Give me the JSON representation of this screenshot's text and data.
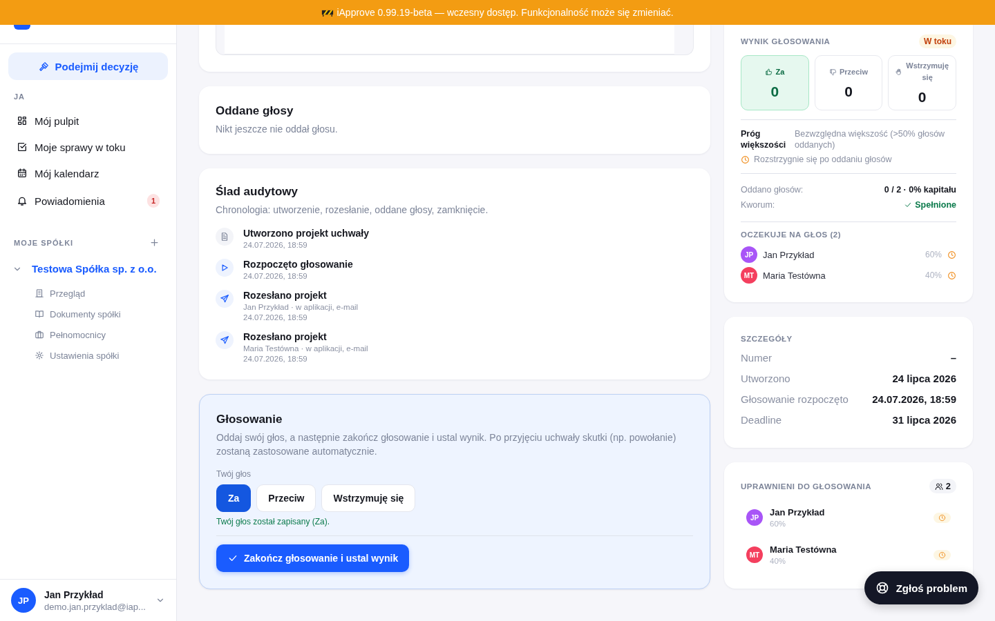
{
  "banner": {
    "text": "iApprove 0.99.19-beta — wczesny dostęp. Funkcjonalność może się zmieniać."
  },
  "sidebar": {
    "action_button": "Podejmij decyzję",
    "section_title": "JA",
    "items": [
      {
        "label": "Mój pulpit",
        "selected": false
      },
      {
        "label": "Moje sprawy w toku",
        "selected": false
      },
      {
        "label": "Mój kalendarz",
        "selected": false
      },
      {
        "label": "Powiadomienia",
        "selected": false,
        "badge": "1"
      }
    ],
    "companies_title": "MOJE SPÓŁKI",
    "companies": [
      {
        "name": "Testowa Spółka sp. z o.o.",
        "expanded": true,
        "children": [
          {
            "label": "Przegląd"
          },
          {
            "label": "Dokumenty spółki"
          },
          {
            "label": "Pełnomocnicy"
          },
          {
            "label": "Ustawienia spółki"
          }
        ]
      }
    ],
    "user": {
      "initials": "JP",
      "name": "Jan Przykład",
      "email": "demo.jan.przyklad@iap..."
    }
  },
  "votes_card": {
    "title": "Oddane głosy",
    "text": "Nikt jeszcze nie oddał głosu."
  },
  "audit": {
    "title": "Ślad audytowy",
    "subtitle": "Chronologia: utworzenie, rozesłanie, oddane głosy, zamknięcie.",
    "events": [
      {
        "kind": "created",
        "title": "Utworzono projekt uchwały",
        "time": "24.07.2026, 18:59"
      },
      {
        "kind": "started",
        "title": "Rozpoczęto głosowanie",
        "time": "24.07.2026, 18:59"
      },
      {
        "kind": "sent",
        "title": "Rozesłano projekt",
        "detail": "Jan Przykład · w aplikacji, e-mail",
        "time": "24.07.2026, 18:59"
      },
      {
        "kind": "sent",
        "title": "Rozesłano projekt",
        "detail": "Maria Testówna · w aplikacji, e-mail",
        "time": "24.07.2026, 18:59"
      }
    ]
  },
  "voting": {
    "title": "Głosowanie",
    "text": "Oddaj swój głos, a następnie zakończ głosowanie i ustal wynik. Po przyjęciu uchwały skutki (np. powołanie) zostaną zastosowane automatycznie.",
    "label": "Twój głos",
    "options": [
      {
        "label": "Za",
        "selected": true
      },
      {
        "label": "Przeciw",
        "selected": false
      },
      {
        "label": "Wstrzymuję się",
        "selected": false
      }
    ],
    "message": "Twój głos został zapisany (Za).",
    "finish_button": "Zakończ głosowanie i ustal wynik"
  },
  "result": {
    "title": "WYNIK GŁOSOWANIA",
    "status": "W toku",
    "tally": [
      {
        "kind": "for",
        "label": "Za",
        "count": "0",
        "highlighted": true
      },
      {
        "kind": "against",
        "label": "Przeciw",
        "count": "0",
        "highlighted": false
      },
      {
        "kind": "abstain",
        "label": "Wstrzymuję się",
        "count": "0",
        "highlighted": false
      }
    ],
    "threshold_label": "Próg większości",
    "threshold_value": "Bezwzględna większość (>50% głosów oddanych)",
    "threshold_note": "Rozstrzygnie się po oddaniu głosów",
    "stats": [
      {
        "label": "Oddano głosów:",
        "value": "0 / 2 · 0% kapitału",
        "kind": "plain"
      },
      {
        "label": "Kworum:",
        "value": "Spełnione",
        "kind": "ok"
      }
    ],
    "pending_title": "OCZEKUJE NA GŁOS (2)",
    "pending": [
      {
        "initials": "JP",
        "name": "Jan Przykład",
        "share": "60%",
        "color": "#a855f7"
      },
      {
        "initials": "MT",
        "name": "Maria Testówna",
        "share": "40%",
        "color": "#f43f5e"
      }
    ]
  },
  "details": {
    "title": "SZCZEGÓŁY",
    "rows": [
      {
        "label": "Numer",
        "value": "–"
      },
      {
        "label": "Utworzono",
        "value": "24 lipca 2026"
      },
      {
        "label": "Głosowanie rozpoczęto",
        "value": "24.07.2026, 18:59"
      },
      {
        "label": "Deadline",
        "value": "31 lipca 2026"
      }
    ]
  },
  "eligible": {
    "title": "UPRAWNIENI DO GŁOSOWANIA",
    "count": "2",
    "voters": [
      {
        "initials": "JP",
        "name": "Jan Przykład",
        "share": "60%",
        "color": "#a855f7"
      },
      {
        "initials": "MT",
        "name": "Maria Testówna",
        "share": "40%",
        "color": "#f43f5e"
      }
    ]
  },
  "report_button": "Zgłoś problem"
}
